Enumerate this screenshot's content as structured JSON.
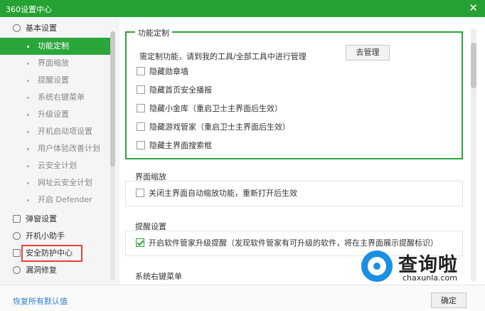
{
  "window": {
    "title": "360设置中心",
    "close_glyph": "✕"
  },
  "sidebar": {
    "groups": [
      {
        "label": "基本设置",
        "icon": "gear-icon"
      },
      {
        "label": "弹窗设置",
        "icon": "popup-icon"
      },
      {
        "label": "开机小助手",
        "icon": "clock-icon"
      },
      {
        "label": "安全防护中心",
        "icon": "shield-icon"
      },
      {
        "label": "漏洞修复",
        "icon": "bug-icon"
      }
    ],
    "items": [
      {
        "label": "功能定制",
        "active": true
      },
      {
        "label": "界面缩放"
      },
      {
        "label": "提醒设置"
      },
      {
        "label": "系统右键菜单"
      },
      {
        "label": "升级设置"
      },
      {
        "label": "开机启动项设置"
      },
      {
        "label": "用户体验改善计划"
      },
      {
        "label": "云安全计划"
      },
      {
        "label": "网址云安全计划"
      },
      {
        "label": "开启 Defender"
      }
    ]
  },
  "sections": {
    "custom": {
      "title": "功能定制",
      "description": "需定制功能，请到我的工具/全部工具中进行管理",
      "button_label": "去管理",
      "options": [
        {
          "label": "隐藏勋章墙",
          "checked": false
        },
        {
          "label": "隐藏首页安全播报",
          "checked": false
        },
        {
          "label": "隐藏小金库（重启卫士主界面后生效）",
          "checked": false
        },
        {
          "label": "隐藏游戏管家（重启卫士主界面后生效）",
          "checked": false
        },
        {
          "label": "隐藏主界面搜索框",
          "checked": false
        }
      ]
    },
    "zoom": {
      "title": "界面缩放",
      "options": [
        {
          "label": "关闭主界面自动缩放功能，重新打开后生效",
          "checked": false
        }
      ]
    },
    "reminder": {
      "title": "提醒设置",
      "options": [
        {
          "label": "开启软件管家升级提醒（发现软件管家有可升级的软件，将在主界面展示提醒标识）",
          "checked": true
        }
      ]
    },
    "context_menu": {
      "title": "系统右键菜单"
    }
  },
  "footer": {
    "restore_label": "恢复所有默认值",
    "ok_label": "确定"
  },
  "watermark": {
    "text": "查询啦",
    "url": "chaxunla.com"
  },
  "colors": {
    "accent": "#2aa63b",
    "titlebar": "#25a233",
    "highlight": "#e6423a",
    "link": "#2f7fd0"
  }
}
